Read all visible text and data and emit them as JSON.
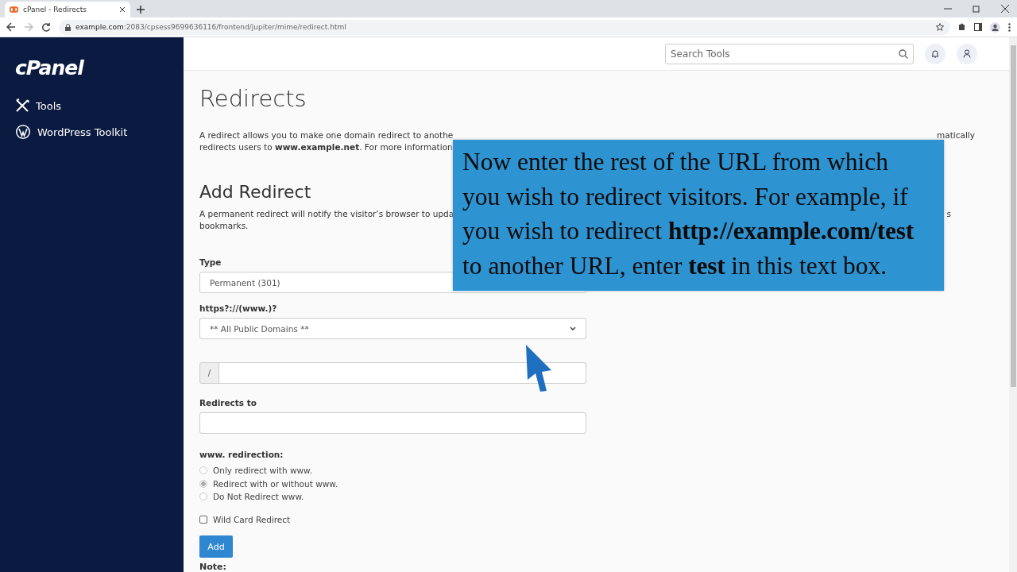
{
  "browser": {
    "tab_title": "cPanel - Redirects",
    "url_host": "example.com",
    "url_path": ":2083/cpsess9699636116/frontend/jupiter/mime/redirect.html"
  },
  "sidebar": {
    "logo": "cPanel",
    "items": [
      {
        "label": "Tools",
        "kind": "tools"
      },
      {
        "label": "WordPress Toolkit",
        "kind": "wordpress"
      }
    ]
  },
  "header": {
    "search": {
      "placeholder": "Search Tools"
    }
  },
  "page": {
    "title": "Redirects",
    "intro": [
      {
        "text": "A redirect allows you to make one domain redirect to anothe",
        "tail": "matically"
      },
      {
        "text": "redirects users to **www.example.net**. For more information"
      }
    ],
    "section_title": "Add Redirect",
    "section_text": [
      {
        "text": "A permanent redirect will notify the visitor’s browser to upda",
        "tail": "s"
      },
      {
        "text": "bookmarks."
      }
    ],
    "form": {
      "type": {
        "label": "Type",
        "value": "Permanent (301)"
      },
      "domain": {
        "label": "https?://(www.)?",
        "value": "** All Public Domains **"
      },
      "path": {
        "prefix": "/"
      },
      "redirects_to": {
        "label": "Redirects to"
      },
      "www_redirection": {
        "label": "www. redirection:",
        "options": [
          {
            "label": "Only redirect with www.",
            "selected": false
          },
          {
            "label": "Redirect with or without www.",
            "selected": true
          },
          {
            "label": "Do Not Redirect www.",
            "selected": false
          }
        ]
      },
      "wildcard": {
        "label": "Wild Card Redirect",
        "checked": false
      },
      "button": "Add",
      "note": "Note:"
    }
  },
  "callout": {
    "text": "Now enter the rest of the URL from which you wish to redirect visitors. For example, if you wish to redirect **http://example.com/test** to another URL, enter **test** in this text box."
  }
}
